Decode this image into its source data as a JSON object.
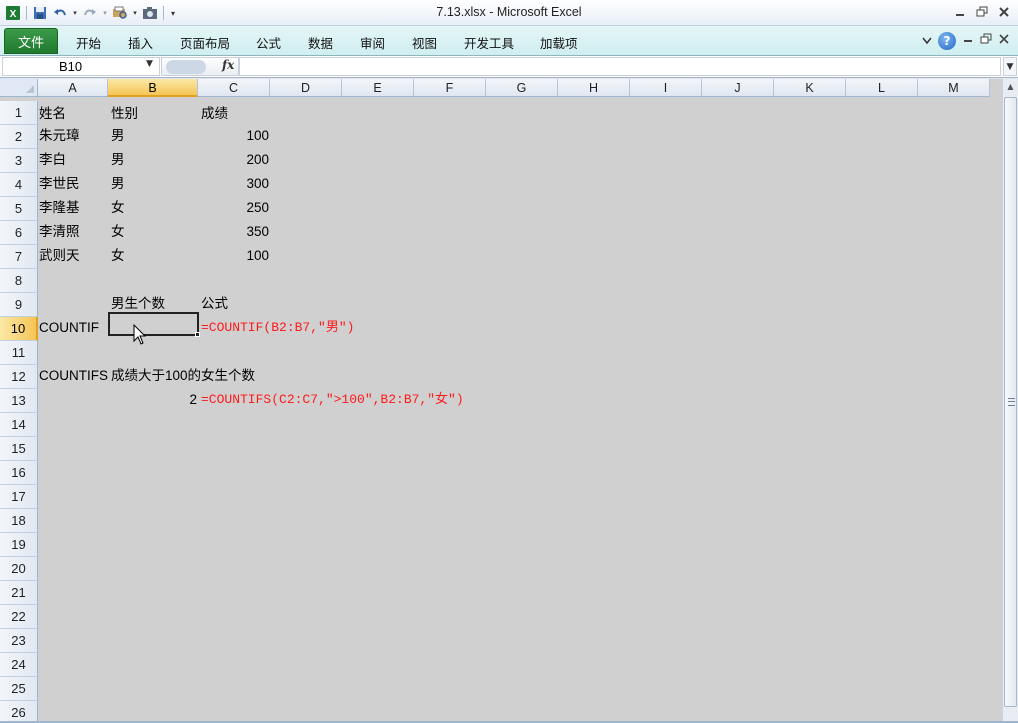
{
  "window": {
    "title": "7.13.xlsx  -  Microsoft Excel",
    "controls": [
      "minimize",
      "restore",
      "close"
    ]
  },
  "quick_access": {
    "icons": [
      "excel-logo-icon",
      "save-icon",
      "undo-icon",
      "redo-icon",
      "print-preview-icon",
      "camera-icon",
      "customize-icon"
    ]
  },
  "ribbon": {
    "file_tab": "文件",
    "tabs": [
      "开始",
      "插入",
      "页面布局",
      "公式",
      "数据",
      "审阅",
      "视图",
      "开发工具",
      "加载项"
    ]
  },
  "formula_bar": {
    "name_box": "B10",
    "fx_label": "fx",
    "content": ""
  },
  "sheet": {
    "selected_cell": "B10",
    "selected_column": "B",
    "selected_row": "10",
    "columns": [
      "A",
      "B",
      "C",
      "D",
      "E",
      "F",
      "G",
      "H",
      "I",
      "J",
      "K",
      "L",
      "M"
    ],
    "rows": [
      "1",
      "2",
      "3",
      "4",
      "5",
      "6",
      "7",
      "8",
      "9",
      "10",
      "11",
      "12",
      "13",
      "14",
      "15",
      "16",
      "17",
      "18",
      "19",
      "20",
      "21",
      "22",
      "23",
      "24",
      "25",
      "26"
    ],
    "cells": {
      "A1": "姓名",
      "B1": "性别",
      "C1": "成绩",
      "A2": "朱元璋",
      "B2": "男",
      "C2": "100",
      "A3": "李白",
      "B3": "男",
      "C3": "200",
      "A4": "李世民",
      "B4": "男",
      "C4": "300",
      "A5": "李隆基",
      "B5": "女",
      "C5": "250",
      "A6": "李清照",
      "B6": "女",
      "C6": "350",
      "A7": "武则天",
      "B7": "女",
      "C7": "100",
      "B9": "男生个数",
      "C9": "公式",
      "A10": "COUNTIF",
      "C10": "=COUNTIF(B2:B7,\"男\")",
      "A12": "COUNTIFS",
      "B12": "成绩大于100的女生个数",
      "B13": "2",
      "C13": "=COUNTIFS(C2:C7,\">100\",B2:B7,\"女\")"
    }
  },
  "colors": {
    "file_tab": "#1f7a2e",
    "selection_header": "#f5c556",
    "formula_text": "#ff1a1a",
    "grid_background": "#d0d0d0"
  }
}
